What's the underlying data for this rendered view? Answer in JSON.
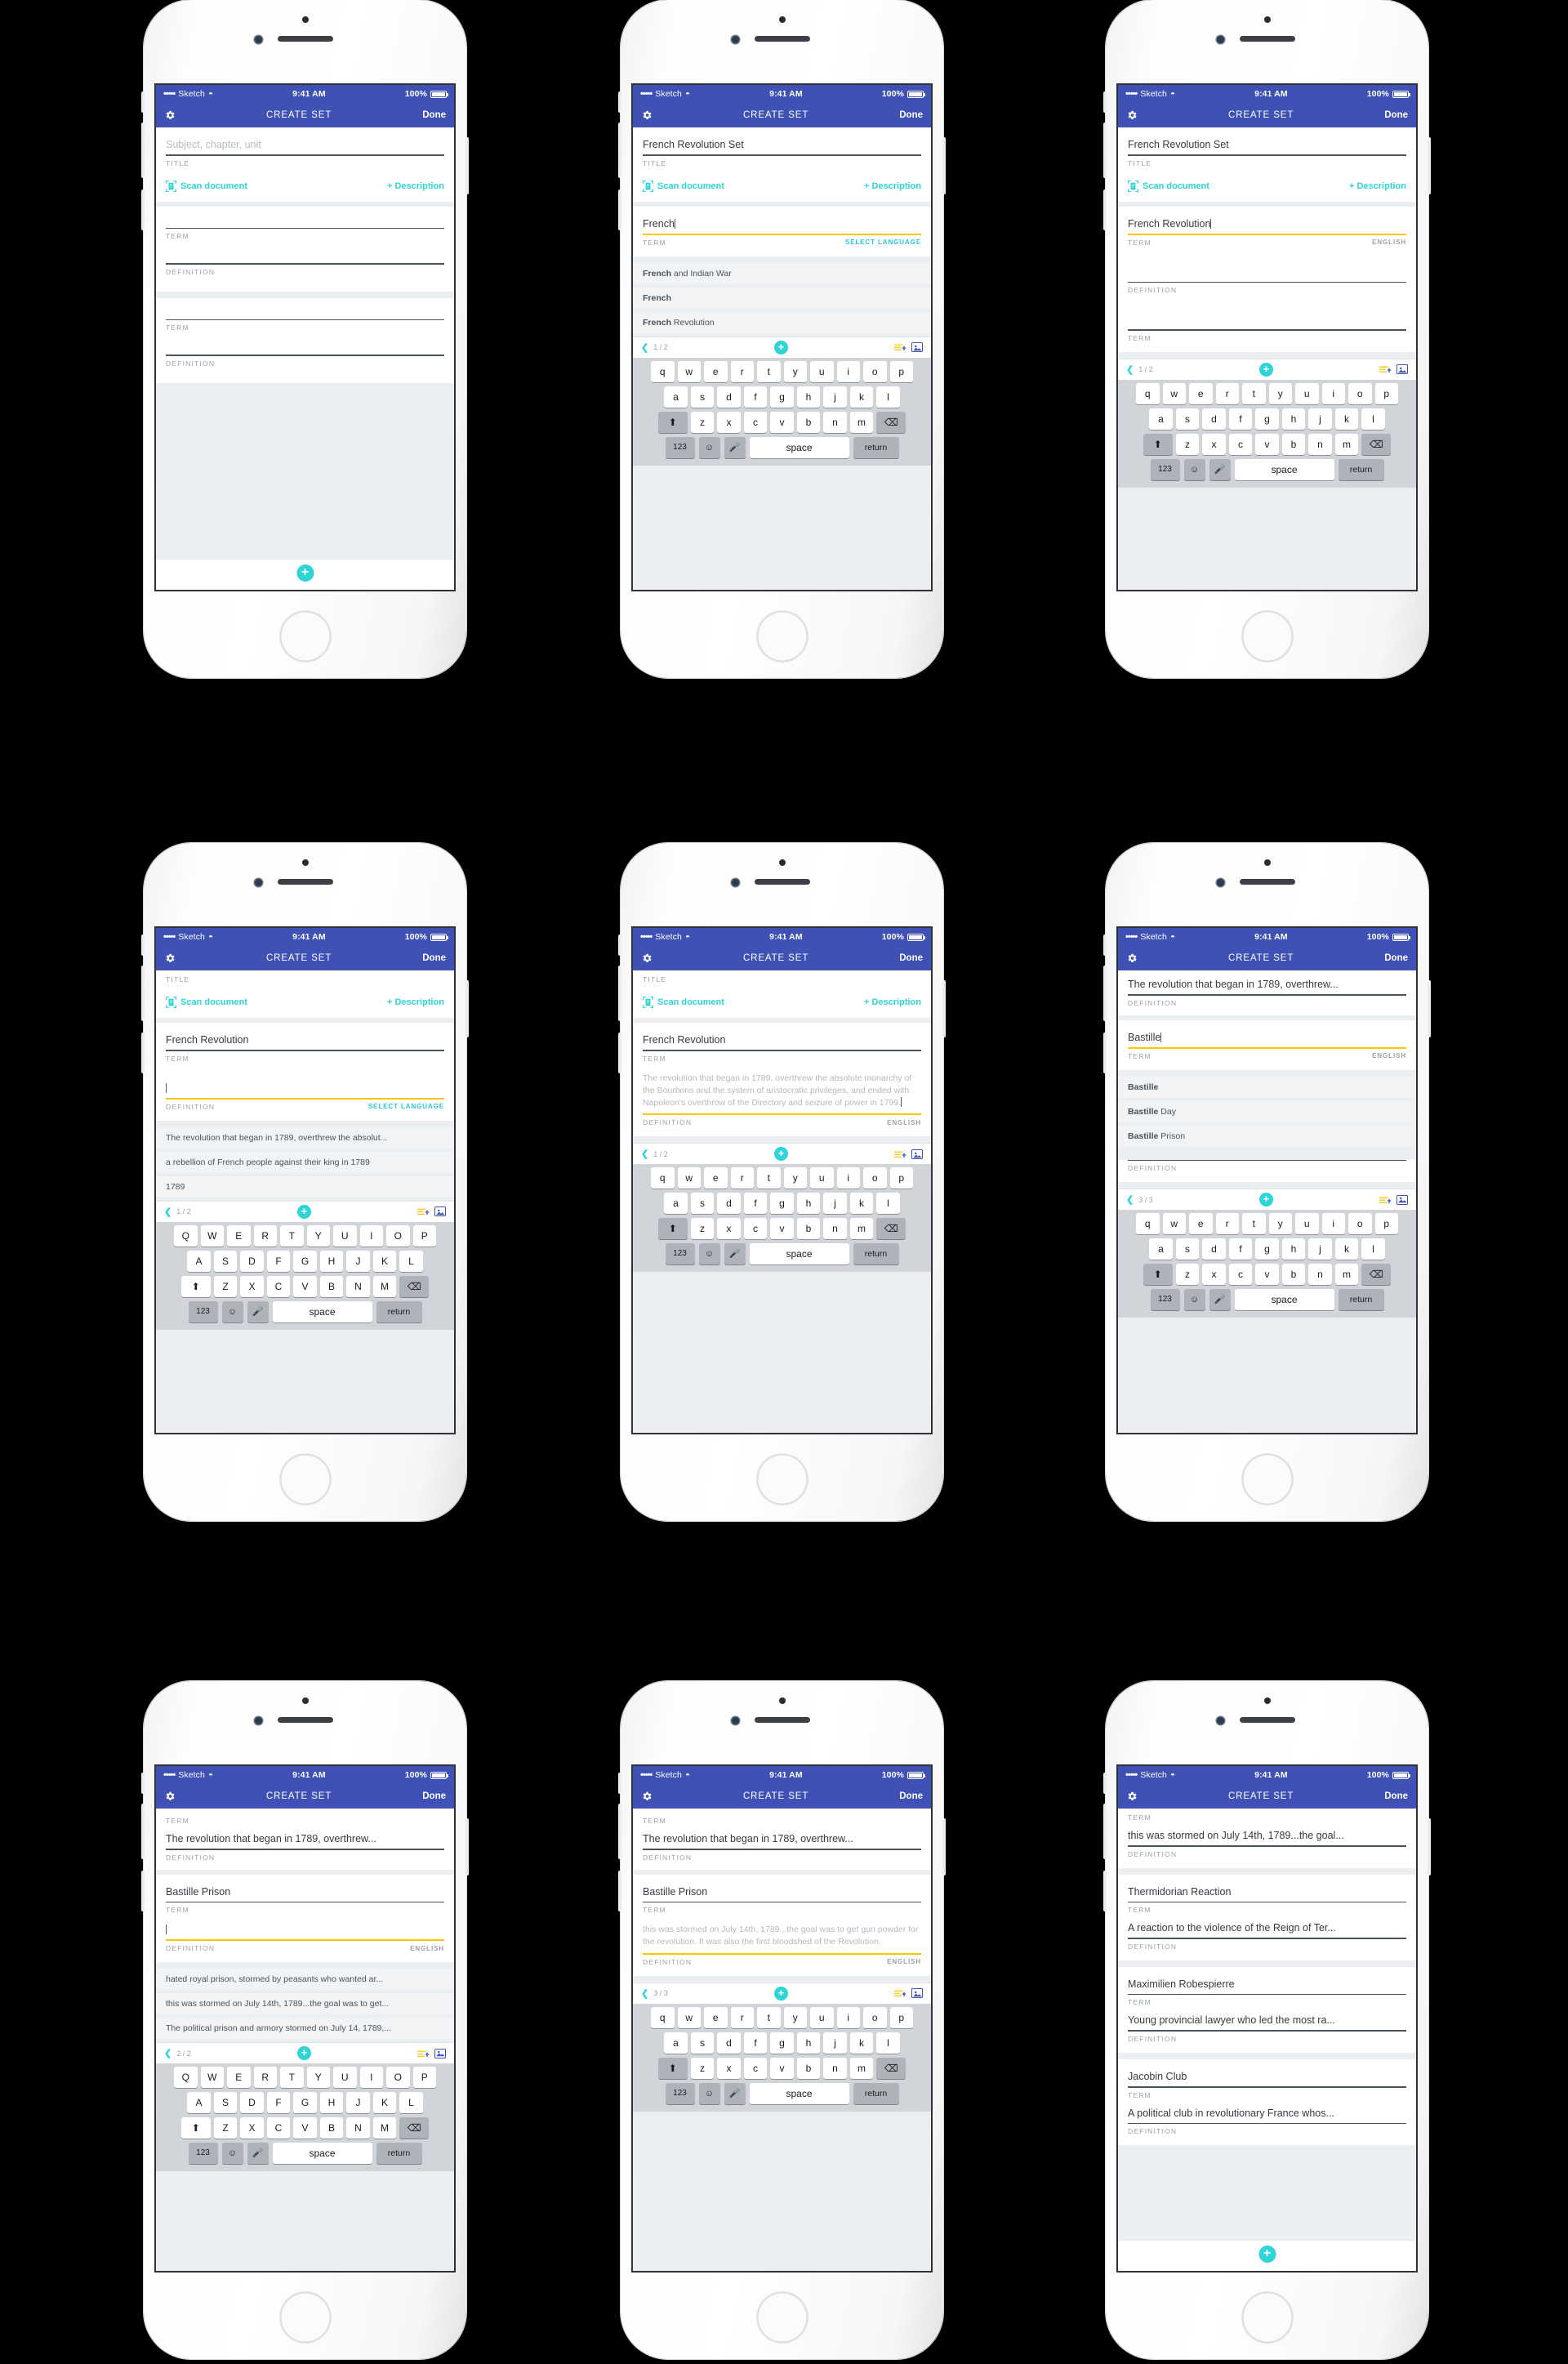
{
  "status_bar": {
    "dots": "•••••",
    "carrier": "Sketch",
    "time": "9:41 AM",
    "battery": "100%"
  },
  "nav": {
    "title": "CREATE SET",
    "done": "Done",
    "gear_icon": "gear-icon"
  },
  "labels": {
    "title": "TITLE",
    "term": "TERM",
    "definition": "DEFINITION",
    "select_language": "SELECT LANGUAGE",
    "english": "ENGLISH",
    "scan": "Scan document",
    "description": "+ Description",
    "title_placeholder": "Subject, chapter, unit"
  },
  "keyboard": {
    "rows_lower": [
      [
        "q",
        "w",
        "e",
        "r",
        "t",
        "y",
        "u",
        "i",
        "o",
        "p"
      ],
      [
        "a",
        "s",
        "d",
        "f",
        "g",
        "h",
        "j",
        "k",
        "l"
      ],
      [
        "z",
        "x",
        "c",
        "v",
        "b",
        "n",
        "m"
      ]
    ],
    "rows_upper": [
      [
        "Q",
        "W",
        "E",
        "R",
        "T",
        "Y",
        "U",
        "I",
        "O",
        "P"
      ],
      [
        "A",
        "S",
        "D",
        "F",
        "G",
        "H",
        "J",
        "K",
        "L"
      ],
      [
        "Z",
        "X",
        "C",
        "V",
        "B",
        "N",
        "M"
      ]
    ],
    "num": "123",
    "space": "space",
    "return": "return",
    "shift_icon": "shift-icon",
    "delete_icon": "backspace-icon",
    "emoji_icon": "emoji-icon",
    "mic_icon": "microphone-icon"
  },
  "phones": [
    {
      "id": "p1",
      "name": "empty-create-set",
      "set_title": "",
      "set_title_placeholder": "Subject, chapter, unit",
      "keyboard": false,
      "fab": true,
      "cards": [
        {
          "term": "",
          "definition": ""
        },
        {
          "term": "",
          "definition": ""
        }
      ]
    },
    {
      "id": "p2",
      "name": "term-autocomplete-french",
      "set_title": "French Revolution Set",
      "term_value": "French",
      "term_label_right": "SELECT LANGUAGE",
      "suggestions": [
        {
          "bold": "French",
          "rest": " and Indian War"
        },
        {
          "bold": "French",
          "rest": ""
        },
        {
          "bold": "French",
          "rest": " Revolution"
        }
      ],
      "counter": "1 / 2",
      "keyboard": true,
      "keyboard_case": "lower"
    },
    {
      "id": "p3",
      "name": "term-entered-french-revolution",
      "set_title": "French Revolution Set",
      "term_value": "French Revolution",
      "term_label_right": "ENGLISH",
      "counter": "1 / 2",
      "keyboard": true,
      "keyboard_case": "lower"
    },
    {
      "id": "p4",
      "name": "definition-autocomplete",
      "term_value": "French Revolution",
      "definition_value": "",
      "def_label_right": "SELECT LANGUAGE",
      "suggestions": [
        "The revolution that began in 1789, overthrew the absolut...",
        "a rebellion of French people against their king in 1789",
        "1789"
      ],
      "counter": "1 / 2",
      "keyboard": true,
      "keyboard_case": "upper"
    },
    {
      "id": "p5",
      "name": "definition-filled",
      "term_value": "French Revolution",
      "definition_value": "The revolution that began in 1789, overthrew the absolute monarchy of the Bourbons and the system of aristocratic privileges, and ended with Napoleon's overthrow of the Directory and seizure of power in 1799.",
      "def_label_right": "ENGLISH",
      "counter": "1 / 2",
      "keyboard": true,
      "keyboard_case": "lower"
    },
    {
      "id": "p6",
      "name": "second-term-bastille",
      "prev_term": "The revolution that began in 1789, overthrew...",
      "term_value": "Bastille",
      "term_label_right": "ENGLISH",
      "suggestions": [
        {
          "bold": "Bastille",
          "rest": ""
        },
        {
          "bold": "Bastille",
          "rest": " Day"
        },
        {
          "bold": "Bastille",
          "rest": " Prison"
        }
      ],
      "counter": "3 / 3",
      "keyboard": true,
      "keyboard_case": "lower"
    },
    {
      "id": "p7",
      "name": "bastille-prison-definition-suggestions",
      "prev_term": "The revolution that began in 1789, overthrew...",
      "term_value": "Bastille Prison",
      "def_label_right": "ENGLISH",
      "suggestions": [
        "hated royal prison, stormed by peasants who wanted ar...",
        "this was stormed on July 14th, 1789...the goal was to get...",
        "The political prison and armory stormed on July 14, 1789,..."
      ],
      "counter": "2 / 2",
      "keyboard": true,
      "keyboard_case": "upper"
    },
    {
      "id": "p8",
      "name": "bastille-prison-definition-filled",
      "prev_term": "The revolution that began in 1789, overthrew...",
      "term_value": "Bastille Prison",
      "definition_value": "this was stormed on July 14th, 1789...the goal was to get gun powder for the revolution. It was also the first bloodshed of the Revolution.",
      "def_label_right": "ENGLISH",
      "counter": "3 / 3",
      "keyboard": true,
      "keyboard_case": "lower"
    },
    {
      "id": "p9",
      "name": "set-term-list",
      "first_term": "this was stormed on July 14th, 1789...the goal...",
      "rows": [
        {
          "title": "Thermidorian Reaction",
          "sub": "A reaction to the violence of the Reign of Ter..."
        },
        {
          "title": "Maximilien Robespierre",
          "sub": "Young provincial lawyer who led the most ra..."
        },
        {
          "title": "Jacobin Club",
          "sub": "A political club in revolutionary France whos..."
        }
      ],
      "keyboard": false,
      "fab": true
    }
  ],
  "colors": {
    "nav_blue": "#3f51b5",
    "accent_teal": "#2ed4d6",
    "highlight_yellow": "#ffc400",
    "rule_dark": "#4a525c",
    "label_grey": "#9aa2ab"
  }
}
